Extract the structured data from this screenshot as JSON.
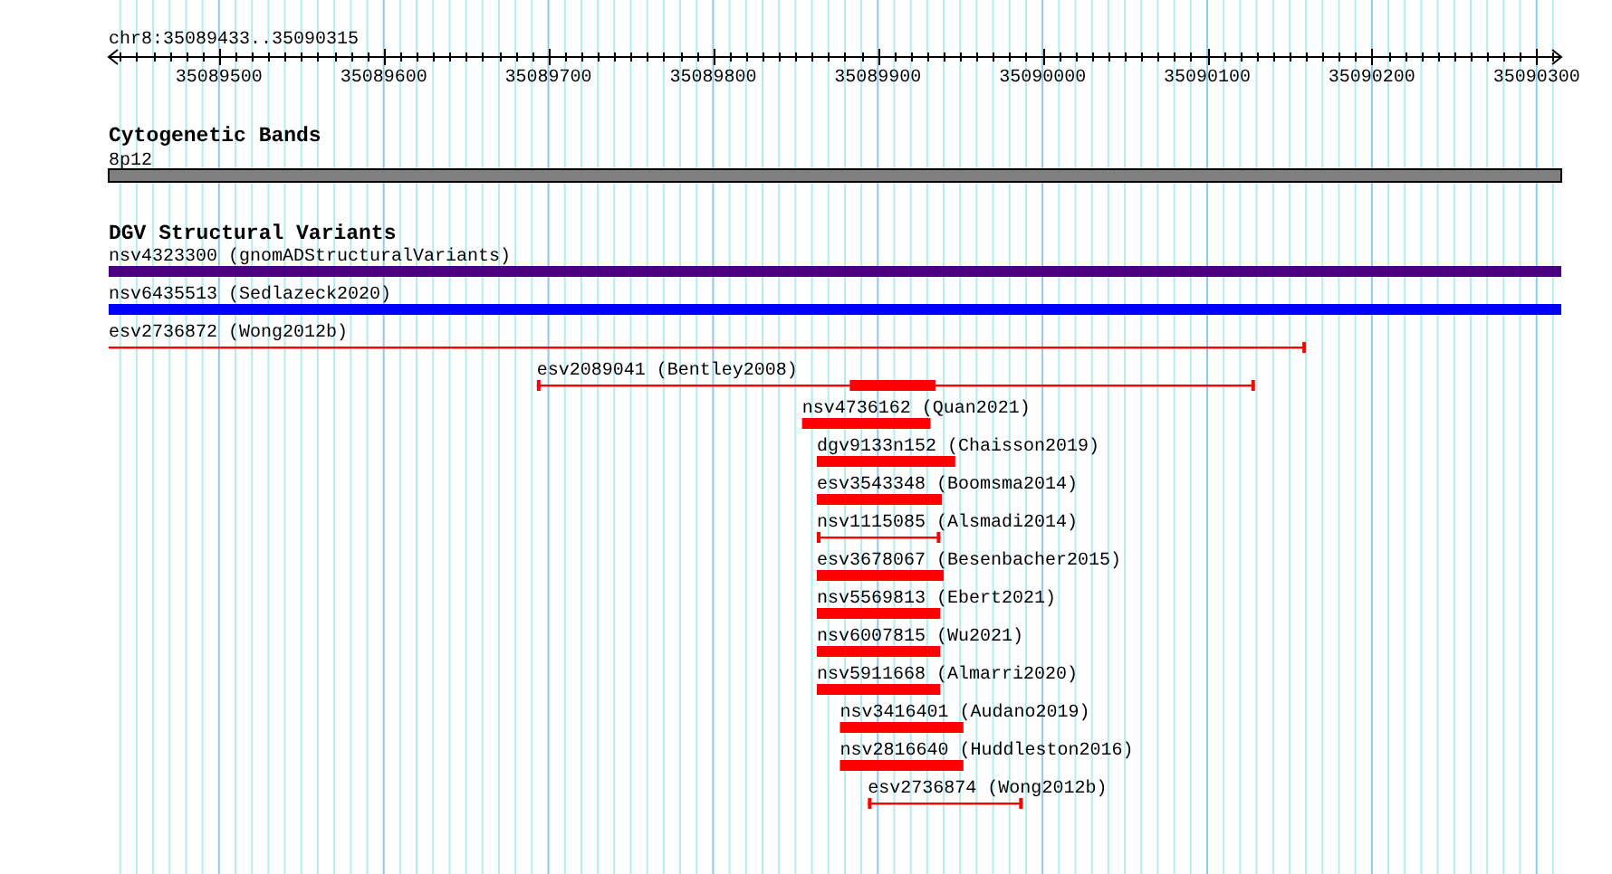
{
  "ruler": {
    "location": "chr8:35089433..35090315",
    "tick_labels": [
      "35089500",
      "35089600",
      "35089700",
      "35089800",
      "35089900",
      "35090000",
      "35090100",
      "35090200",
      "35090300"
    ]
  },
  "tracks": [
    {
      "title": "Cytogenetic Bands",
      "kind": "bands",
      "features": [
        {
          "label": "8p12"
        }
      ]
    },
    {
      "title": "DGV Structural Variants",
      "kind": "variants",
      "features": [
        {
          "label": "nsv4323300 (gnomADStructuralVariants)",
          "kind": "box",
          "color": "#4b0082"
        },
        {
          "label": "nsv6435513 (Sedlazeck2020)",
          "kind": "box",
          "color": "#0000ff"
        },
        {
          "label": "esv2736872 (Wong2012b)",
          "kind": "line",
          "color": "#ff0000"
        },
        {
          "label": "esv2089041 (Bentley2008)",
          "kind": "line",
          "color": "#ff0000"
        },
        {
          "label": "nsv4736162 (Quan2021)",
          "kind": "box",
          "color": "#ff0000"
        },
        {
          "label": "dgv9133n152 (Chaisson2019)",
          "kind": "box",
          "color": "#ff0000"
        },
        {
          "label": "esv3543348 (Boomsma2014)",
          "kind": "box",
          "color": "#ff0000"
        },
        {
          "label": "nsv1115085 (Alsmadi2014)",
          "kind": "line",
          "color": "#ff0000"
        },
        {
          "label": "esv3678067 (Besenbacher2015)",
          "kind": "box",
          "color": "#ff0000"
        },
        {
          "label": "nsv5569813 (Ebert2021)",
          "kind": "box",
          "color": "#ff0000"
        },
        {
          "label": "nsv6007815 (Wu2021)",
          "kind": "box",
          "color": "#ff0000"
        },
        {
          "label": "nsv5911668 (Almarri2020)",
          "kind": "box",
          "color": "#ff0000"
        },
        {
          "label": "nsv3416401 (Audano2019)",
          "kind": "box",
          "color": "#ff0000"
        },
        {
          "label": "nsv2816640 (Huddleston2016)",
          "kind": "box",
          "color": "#ff0000"
        },
        {
          "label": "esv2736874 (Wong2012b)",
          "kind": "line",
          "color": "#ff0000"
        }
      ]
    }
  ]
}
